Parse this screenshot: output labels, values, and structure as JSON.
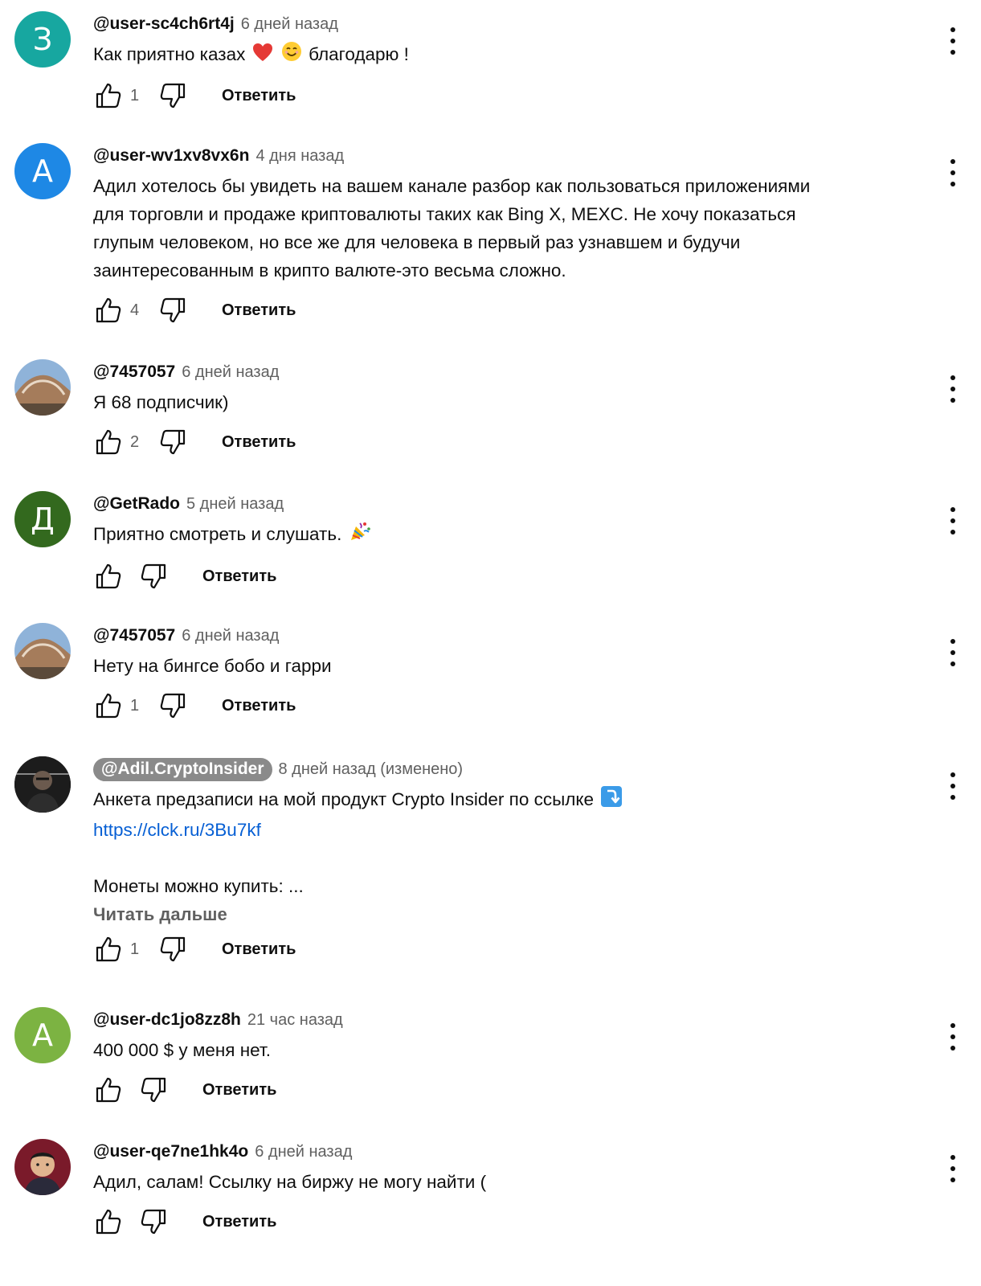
{
  "colors": {
    "avatar_teal": "#17a7a0",
    "avatar_blue": "#1e88e5",
    "avatar_dark_green": "#33691e",
    "avatar_green": "#7cb342",
    "link": "#065fd4",
    "owner_badge": "#8a8a8a"
  },
  "reply_label": "Ответить",
  "comments": [
    {
      "avatar_letter": "З",
      "author": "@user-sc4ch6rt4j",
      "time": "6 дней назад",
      "text_before": "Как приятно казах",
      "emoji_1": "red-heart",
      "emoji_2": "smiling-face",
      "text_after": "благодарю !",
      "likes": "1"
    },
    {
      "avatar_letter": "А",
      "author": "@user-wv1xv8vx6n",
      "time": "4 дня назад",
      "lines": [
        "Адил хотелось бы увидеть на вашем канале разбор как пользоваться приложениями",
        "для торговли и продаже криптовалюты таких как Bing X, MEXC. Не хочу показаться",
        "глупым человеком, но все же для человека в первый раз узнавшем и будучи",
        "заинтересованным в крипто валюте-это весьма сложно."
      ],
      "likes": "4"
    },
    {
      "author": "@7457057",
      "time": "6 дней назад",
      "text": "Я 68 подписчик)",
      "likes": "2"
    },
    {
      "avatar_letter": "Д",
      "author": "@GetRado",
      "time": "5 дней назад",
      "text": "Приятно смотреть и слушать.",
      "emoji": "party-popper",
      "likes": ""
    },
    {
      "author": "@7457057",
      "time": "6 дней назад",
      "text": "Нету на бингсе бобо и гарри",
      "likes": "1"
    },
    {
      "author": "@Adil.CryptoInsider",
      "time": "8 дней назад (изменено)",
      "text": "Анкета предзаписи на мой продукт Crypto Insider по ссылке",
      "emoji": "arrow-curving-down",
      "link": "https://clck.ru/3Bu7kf",
      "text_2": "Монеты можно купить: ...",
      "read_more": "Читать дальше",
      "likes": "1"
    },
    {
      "avatar_letter": "А",
      "author": "@user-dc1jo8zz8h",
      "time": "21 час назад",
      "text": "400 000 $ у меня нет.",
      "likes": ""
    },
    {
      "author": "@user-qe7ne1hk4o",
      "time": "6 дней назад",
      "text": "Адил, салам! Ссылку на биржу не могу найти (",
      "likes": ""
    }
  ]
}
